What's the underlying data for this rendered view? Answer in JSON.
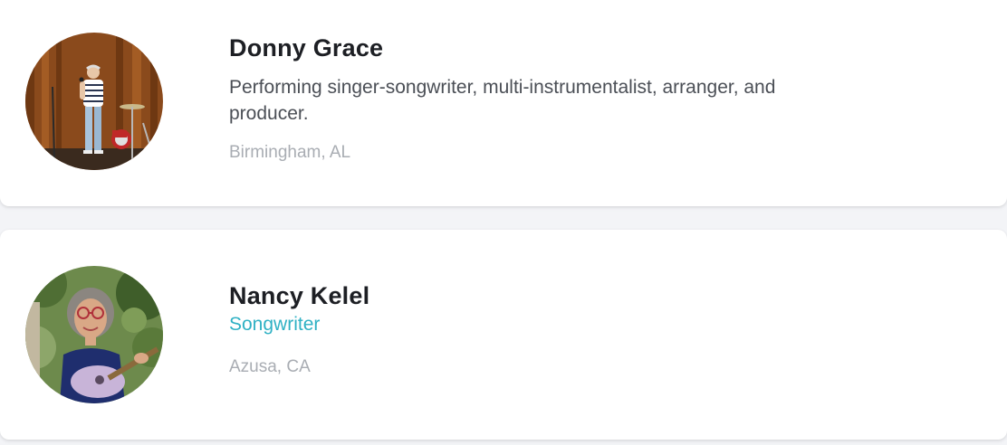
{
  "profiles": [
    {
      "name": "Donny Grace",
      "bio": "Performing singer-songwriter, multi-instrumentalist, arranger, and producer.",
      "location": "Birmingham, AL",
      "avatar_icon": "performer-on-stage-photo"
    },
    {
      "name": "Nancy Kelel",
      "role": "Songwriter",
      "location": "Azusa, CA",
      "avatar_icon": "woman-with-guitar-photo"
    }
  ],
  "colors": {
    "background": "#f3f4f7",
    "card": "#ffffff",
    "name": "#1d1f24",
    "bio": "#4b4f56",
    "role_accent": "#2fb1c4",
    "location": "#a9adb3"
  }
}
